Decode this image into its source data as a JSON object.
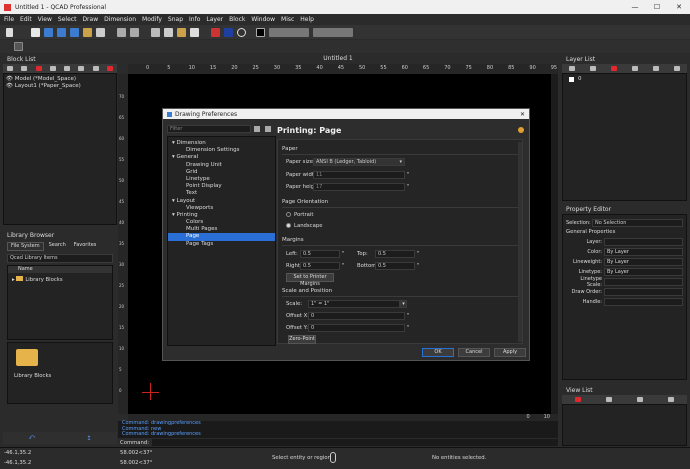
{
  "titlebar": {
    "title": "Untitled 1 - QCAD Professional",
    "min": "—",
    "max": "☐",
    "close": "✕"
  },
  "menu": [
    "File",
    "Edit",
    "View",
    "Select",
    "Draw",
    "Dimension",
    "Modify",
    "Snap",
    "Info",
    "Layer",
    "Block",
    "Window",
    "Misc",
    "Help"
  ],
  "block_list": {
    "title": "Block List",
    "items": [
      "Model (*Model_Space)",
      "Layout1 (*Paper_Space)"
    ]
  },
  "library": {
    "title": "Library Browser",
    "tabs": [
      "File System",
      "Search",
      "Favorites"
    ],
    "combo": "Qcad Library Items",
    "col": "Name",
    "tree_item": "Library Blocks",
    "preview_label": "Library Blocks"
  },
  "drawing": {
    "tab": "Untitled 1",
    "ruler_ticks": [
      "0",
      "5",
      "10",
      "15",
      "20",
      "25",
      "30",
      "35",
      "40",
      "45",
      "50",
      "55",
      "60",
      "65",
      "70",
      "75",
      "80",
      "85",
      "90",
      "95"
    ],
    "vruler_ticks": [
      "70",
      "65",
      "60",
      "55",
      "50",
      "45",
      "40",
      "35",
      "30",
      "25",
      "20",
      "15",
      "10",
      "5",
      "0"
    ],
    "corner_ruler": "0",
    "corner_ruler2": "10"
  },
  "command": {
    "history": [
      "Command: drawingpreferences",
      "Command: new",
      "Command: drawingpreferences"
    ],
    "label": "Command:"
  },
  "status": {
    "coord1": "-46.1,35.2",
    "coord2": "58.002<37°",
    "coord3": "-46.1,35.2",
    "coord4": "58.002<37°",
    "prompt": "Select entity or region",
    "entities": "No entities selected."
  },
  "layer_list": {
    "title": "Layer List",
    "layer": "0"
  },
  "property_editor": {
    "title": "Property Editor",
    "selection_label": "Selection:",
    "selection": "No Selection",
    "section": "General Properties",
    "rows": [
      {
        "label": "Layer:",
        "value": ""
      },
      {
        "label": "Color:",
        "value": "By Layer"
      },
      {
        "label": "Lineweight:",
        "value": "By Layer"
      },
      {
        "label": "Linetype:",
        "value": "By Layer"
      },
      {
        "label": "Linetype Scale:",
        "value": ""
      },
      {
        "label": "Draw Order:",
        "value": ""
      },
      {
        "label": "Handle:",
        "value": ""
      }
    ]
  },
  "view_list": {
    "title": "View List"
  },
  "dialog": {
    "title": "Drawing Preferences",
    "filter": "Filter",
    "heading": "Printing: Page",
    "tree": [
      {
        "label": "Dimension",
        "level": 0
      },
      {
        "label": "Dimension Settings",
        "level": 1
      },
      {
        "label": "General",
        "level": 0
      },
      {
        "label": "Drawing Unit",
        "level": 1
      },
      {
        "label": "Grid",
        "level": 1
      },
      {
        "label": "Linetype",
        "level": 1
      },
      {
        "label": "Point Display",
        "level": 1
      },
      {
        "label": "Text",
        "level": 1
      },
      {
        "label": "Layout",
        "level": 0
      },
      {
        "label": "Viewports",
        "level": 1
      },
      {
        "label": "Printing",
        "level": 0
      },
      {
        "label": "Colors",
        "level": 1
      },
      {
        "label": "Multi Pages",
        "level": 1
      },
      {
        "label": "Page",
        "level": 1,
        "selected": true
      },
      {
        "label": "Page Tags",
        "level": 1
      }
    ],
    "paper": {
      "section": "Paper",
      "size_label": "Paper size:",
      "size": "ANSI B (Ledger, Tabloid)",
      "width_label": "Paper width:",
      "width": "11",
      "height_label": "Paper height:",
      "height": "17",
      "unit": "\""
    },
    "orientation": {
      "section": "Page Orientation",
      "portrait": "Portrait",
      "landscape": "Landscape"
    },
    "margins": {
      "section": "Margins",
      "left_label": "Left:",
      "left": "0.5",
      "top_label": "Top:",
      "top": "0.5",
      "right_label": "Right:",
      "right": "0.5",
      "bottom_label": "Bottom:",
      "bottom": "0.5",
      "unit": "\"",
      "set_btn": "Set to Printer Margins"
    },
    "scale": {
      "section": "Scale and Position",
      "scale_label": "Scale:",
      "scale": "1\" = 1\"",
      "offx_label": "Offset X:",
      "offx": "0",
      "offy_label": "Offset Y:",
      "offy": "0",
      "unit": "\"",
      "zero_btn": "Zero-Point"
    },
    "buttons": {
      "ok": "OK",
      "cancel": "Cancel",
      "apply": "Apply"
    }
  },
  "colors": {
    "accent": "#2a6fd6",
    "red": "#e0282e",
    "canvas": "#000000"
  }
}
